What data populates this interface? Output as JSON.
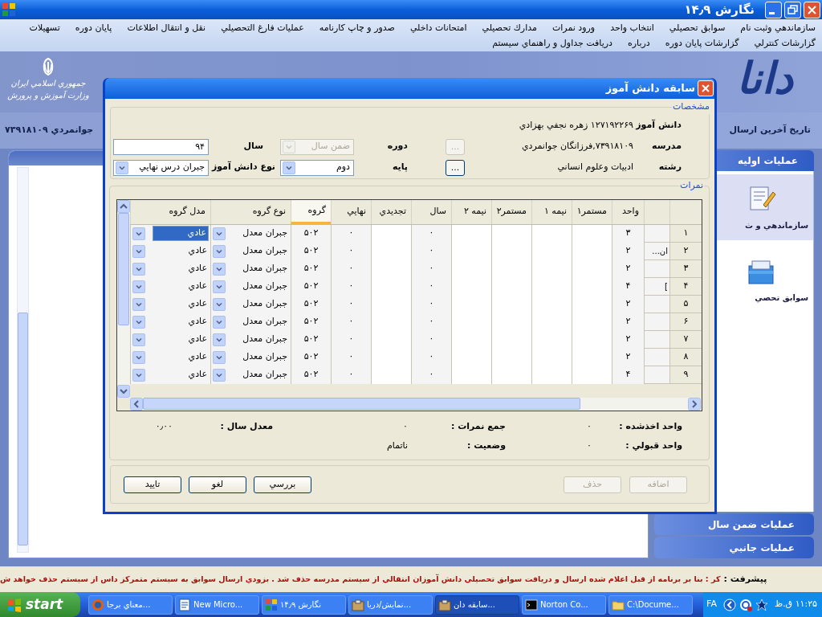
{
  "window": {
    "title": "نگارش ۱۴٫۹"
  },
  "menu": {
    "rows": [
      [
        "سازماندهي وثبت نام",
        "سوابق تحصيلي",
        "انتخاب واحد",
        "ورود نمرات",
        "مدارك تحصيلي",
        "امتحانات داخلي",
        "صدور و چاپ كارنامه",
        "عمليات فارغ التحصيلي",
        "نقل و انتقال اطلاعات",
        "پايان دوره",
        "تسهيلات"
      ],
      [
        "گزارشات كنترلي",
        "گزارشات پايان دوره",
        "درباره",
        "دريافت جداول و راهنماي سيستم"
      ]
    ]
  },
  "banner": {
    "org_lines": [
      "جمهوري اسلامي ايران",
      "وزارت آموزش و پرورش"
    ],
    "logo_text": "دانا",
    "school_line": "جوانمردي  ۷۳۹۱۸۱۰۹",
    "last_send_label": "تاريخ آخرين ارسال"
  },
  "right_panel": {
    "header": "عمليات اوليه",
    "items": [
      {
        "label": "سازماندهي و ث",
        "selected": true
      },
      {
        "label": "سوابق تحصي",
        "selected": false
      }
    ],
    "sections": [
      "عمليات ضمن سال",
      "عمليات جانبي"
    ]
  },
  "dialog": {
    "title": "سابقه دانش آموز",
    "details": {
      "legend": "مشخصات",
      "student": {
        "label": "دانش آموز",
        "value": "۱۲۷۱۹۲۲۶۹ زهره نجفي بهزادي"
      },
      "school": {
        "label": "مدرسه",
        "value": "۷۳۹۱۸۱۰۹,فرزانگان جوانمردي",
        "picker": {
          "label": "...",
          "disabled": true
        }
      },
      "field": {
        "label": "رشته",
        "value": "ادبيات وعلوم انساني",
        "picker": {
          "label": "...",
          "disabled": false
        }
      },
      "course": {
        "label": "دوره",
        "value": "ضمن سال",
        "disabled": true
      },
      "grade": {
        "label": "پايه",
        "value": "دوم",
        "disabled": false
      },
      "year": {
        "label": "سال",
        "value": "۹۴"
      },
      "student_type": {
        "label": "نوع دانش آموز",
        "value": "جبران درس نهايي",
        "disabled": false
      }
    },
    "grades": {
      "legend": "نمرات",
      "columns": [
        {
          "label": "واحد",
          "kind": "plain",
          "sorted": false
        },
        {
          "label": "مستمر۱",
          "kind": "edit",
          "sorted": false
        },
        {
          "label": "نيمه ۱",
          "kind": "edit",
          "sorted": false
        },
        {
          "label": "مستمر۲",
          "kind": "edit",
          "sorted": false
        },
        {
          "label": "نيمه ۲",
          "kind": "edit",
          "sorted": false
        },
        {
          "label": "سال",
          "kind": "plain",
          "sorted": false
        },
        {
          "label": "تجديدي",
          "kind": "edit",
          "sorted": false
        },
        {
          "label": "نهايي",
          "kind": "plain",
          "sorted": false
        },
        {
          "label": "گروه",
          "kind": "plain",
          "sorted": true
        },
        {
          "label": "نوع گروه",
          "kind": "combo",
          "sorted": false
        },
        {
          "label": "مدل گروه",
          "kind": "combo",
          "sorted": false
        }
      ],
      "rows": [
        {
          "number": "۱",
          "selected": true,
          "cells": [
            "۳",
            null,
            null,
            null,
            null,
            "۰",
            null,
            "۰",
            "۵۰۲",
            "جبران معدل",
            "عادي"
          ]
        },
        {
          "number": "۲",
          "selected": false,
          "column_2": "ان...",
          "cells": [
            "۲",
            null,
            null,
            null,
            null,
            "۰",
            null,
            "۰",
            "۵۰۲",
            "جبران معدل",
            "عادي"
          ]
        },
        {
          "number": "۳",
          "selected": false,
          "cells": [
            "۲",
            null,
            null,
            null,
            null,
            "۰",
            null,
            "۰",
            "۵۰۲",
            "جبران معدل",
            "عادي"
          ]
        },
        {
          "number": "۴",
          "selected": false,
          "column_2": "]",
          "cells": [
            "۴",
            null,
            null,
            null,
            null,
            "۰",
            null,
            "۰",
            "۵۰۲",
            "جبران معدل",
            "عادي"
          ]
        },
        {
          "number": "۵",
          "selected": false,
          "cells": [
            "۲",
            null,
            null,
            null,
            null,
            "۰",
            null,
            "۰",
            "۵۰۲",
            "جبران معدل",
            "عادي"
          ]
        },
        {
          "number": "۶",
          "selected": false,
          "cells": [
            "۲",
            null,
            null,
            null,
            null,
            "۰",
            null,
            "۰",
            "۵۰۲",
            "جبران معدل",
            "عادي"
          ]
        },
        {
          "number": "۷",
          "selected": false,
          "cells": [
            "۲",
            null,
            null,
            null,
            null,
            "۰",
            null,
            "۰",
            "۵۰۲",
            "جبران معدل",
            "عادي"
          ]
        },
        {
          "number": "۸",
          "selected": false,
          "cells": [
            "۲",
            null,
            null,
            null,
            null,
            "۰",
            null,
            "۰",
            "۵۰۲",
            "جبران معدل",
            "عادي"
          ]
        },
        {
          "number": "۹",
          "selected": false,
          "cells": [
            "۴",
            null,
            null,
            null,
            null,
            "۰",
            null,
            "۰",
            "۵۰۲",
            "جبران معدل",
            "عادي"
          ]
        }
      ]
    },
    "summary": [
      [
        {
          "label": "واحد اخذشده  :",
          "value": "۰"
        },
        {
          "label": "جمع نمرات  :",
          "value": "۰"
        },
        {
          "label": "معدل سال  :",
          "value": "۰٫۰۰"
        }
      ],
      [
        {
          "label": "واحد قبولي  :",
          "value": "۰"
        },
        {
          "label": "وضعيت  :",
          "value": "ناتمام"
        }
      ]
    ],
    "actions": [
      {
        "label": "اضافه",
        "disabled": true
      },
      {
        "label": "حذف",
        "disabled": true
      }
    ],
    "buttons": [
      {
        "label": "بررسي",
        "disabled": false
      },
      {
        "label": "لغو",
        "disabled": false
      },
      {
        "label": "تاييد",
        "disabled": false
      }
    ]
  },
  "status": {
    "label": "پيشرفت :",
    "message": "كر : بنا بر برنامه از قبل اعلام شده ارسال و دريافت سوابق تحصيلي دانش آموزان انتقالي از سيستم مدرسه حذف  شد . بزودي ارسال سوابق به سيستم متمركز داس از سيستم حذف خواهد ش"
  },
  "taskbar": {
    "start": "start",
    "tasks": [
      {
        "label": "C:\\Docume...",
        "kind": "folder",
        "selected": false
      },
      {
        "label": "Norton Co...",
        "kind": "console",
        "selected": false
      },
      {
        "label": "سابقه دان...",
        "kind": "box",
        "selected": true
      },
      {
        "label": "نمايش/دريا...",
        "kind": "box",
        "selected": false
      },
      {
        "label": "نگارش ۱۴٫۹",
        "kind": "app",
        "selected": false
      },
      {
        "label": "New Micro...",
        "kind": "document",
        "selected": false
      },
      {
        "label": "معناي برجا...",
        "kind": "browser",
        "selected": false
      }
    ],
    "language": "FA",
    "clock": "۱۱:۲۵ ق.ظ"
  }
}
